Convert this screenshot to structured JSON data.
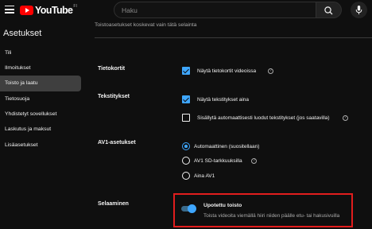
{
  "header": {
    "logo_text": "YouTube",
    "logo_region": "FI",
    "search_placeholder": "Haku"
  },
  "sidebar": {
    "title": "Asetukset",
    "items": [
      {
        "label": "Tili",
        "active": false
      },
      {
        "label": "Ilmoitukset",
        "active": false
      },
      {
        "label": "Toisto ja laatu",
        "active": true
      },
      {
        "label": "Tietosuoja",
        "active": false
      },
      {
        "label": "Yhdistetyt sovellukset",
        "active": false
      },
      {
        "label": "Laskutus ja maksut",
        "active": false
      },
      {
        "label": "Lisäasetukset",
        "active": false
      }
    ]
  },
  "main": {
    "header": "Toistoasetukset koskevat vain tätä selainta",
    "sections": {
      "infocards": {
        "title": "Tietokortit",
        "option": "Näytä tietokortit videoissa",
        "checked": true
      },
      "subtitles": {
        "title": "Tekstitykset",
        "options": [
          {
            "label": "Näytä tekstitykset aina",
            "checked": true
          },
          {
            "label": "Sisällytä automaattisesti luodut tekstitykset (jos saatavilla)",
            "checked": false
          }
        ]
      },
      "av1": {
        "title": "AV1-asetukset",
        "options": [
          {
            "label": "Automaattinen (suositellaan)",
            "selected": true
          },
          {
            "label": "AV1 SD-tarkkuuksilla",
            "selected": false
          },
          {
            "label": "Aina AV1",
            "selected": false
          }
        ]
      },
      "browsing": {
        "title": "Selaaminen",
        "toggle_title": "Upotettu toisto",
        "toggle_desc": "Toista videoita viemällä hiiri niiden päälle etu- tai hakusivuilla",
        "enabled": true
      }
    }
  },
  "colors": {
    "accent": "#3ea6ff",
    "highlight_border": "#e11d1d",
    "background": "#0f0f0f"
  }
}
